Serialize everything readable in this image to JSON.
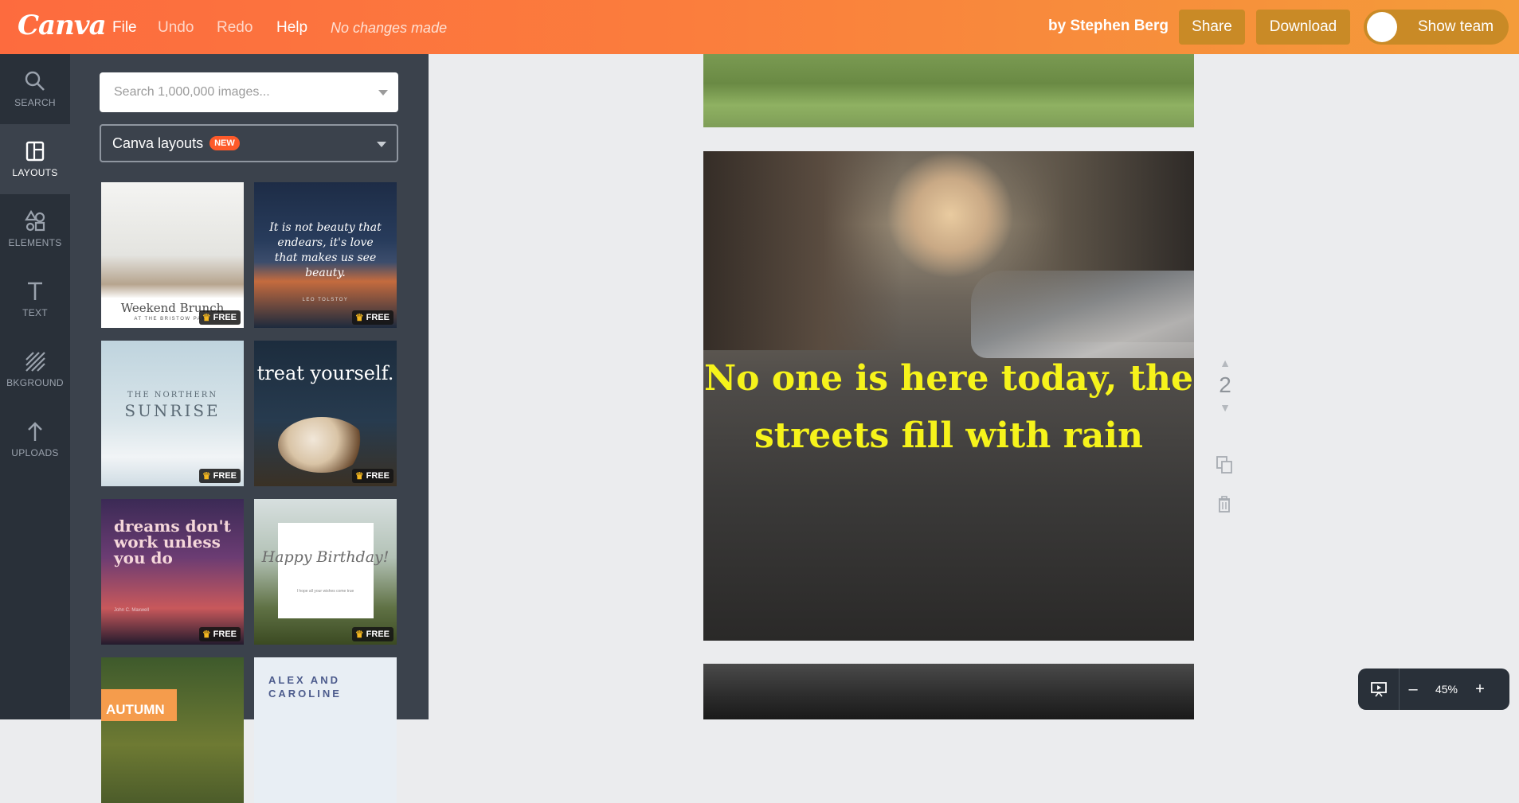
{
  "app": {
    "logo": "Canva",
    "menu": {
      "file": "File",
      "undo": "Undo",
      "redo": "Redo",
      "help": "Help",
      "status": "No changes made"
    },
    "byline": "by Stephen Berg",
    "share": "Share",
    "download": "Download",
    "show_team": "Show team"
  },
  "rail": [
    {
      "label": "SEARCH",
      "icon": "search-icon"
    },
    {
      "label": "LAYOUTS",
      "icon": "layout-icon"
    },
    {
      "label": "ELEMENTS",
      "icon": "shapes-icon"
    },
    {
      "label": "TEXT",
      "icon": "text-icon"
    },
    {
      "label": "BKGROUND",
      "icon": "background-icon"
    },
    {
      "label": "UPLOADS",
      "icon": "upload-icon"
    }
  ],
  "panel": {
    "search_placeholder": "Search 1,000,000 images...",
    "dropdown_label": "Canva layouts",
    "dropdown_badge": "NEW",
    "free_label": "FREE",
    "thumbs": {
      "t1": {
        "title": "Weekend Brunch",
        "sub": "AT THE BRISTOW PARK"
      },
      "t2": {
        "title": "It is not beauty that endears, it's love that makes us see beauty.",
        "sub": "LEO TOLSTOY"
      },
      "t3": {
        "sub": "THE NORTHERN",
        "title": "SUNRISE"
      },
      "t4": {
        "title": "treat yourself."
      },
      "t5": {
        "title": "dreams don't work unless you do",
        "sub": "John C. Maxwell"
      },
      "t6": {
        "title": "Happy Birthday!",
        "sub": "I hope all your wishes come true"
      },
      "t7": {
        "title": "AUTUMN"
      },
      "t8": {
        "title": "ALEX AND CAROLINE"
      }
    }
  },
  "canvas": {
    "quote": "No one is here today, the streets fill with rain",
    "page_number": "2"
  },
  "zoom": {
    "minus": "–",
    "percent": "45%",
    "plus": "+"
  },
  "colors": {
    "topbar_start": "#fd6b3e",
    "topbar_end": "#f49c3a",
    "button": "#c98a26",
    "rail": "#293039",
    "panel": "#3b424c",
    "quote": "#f6f31b"
  }
}
